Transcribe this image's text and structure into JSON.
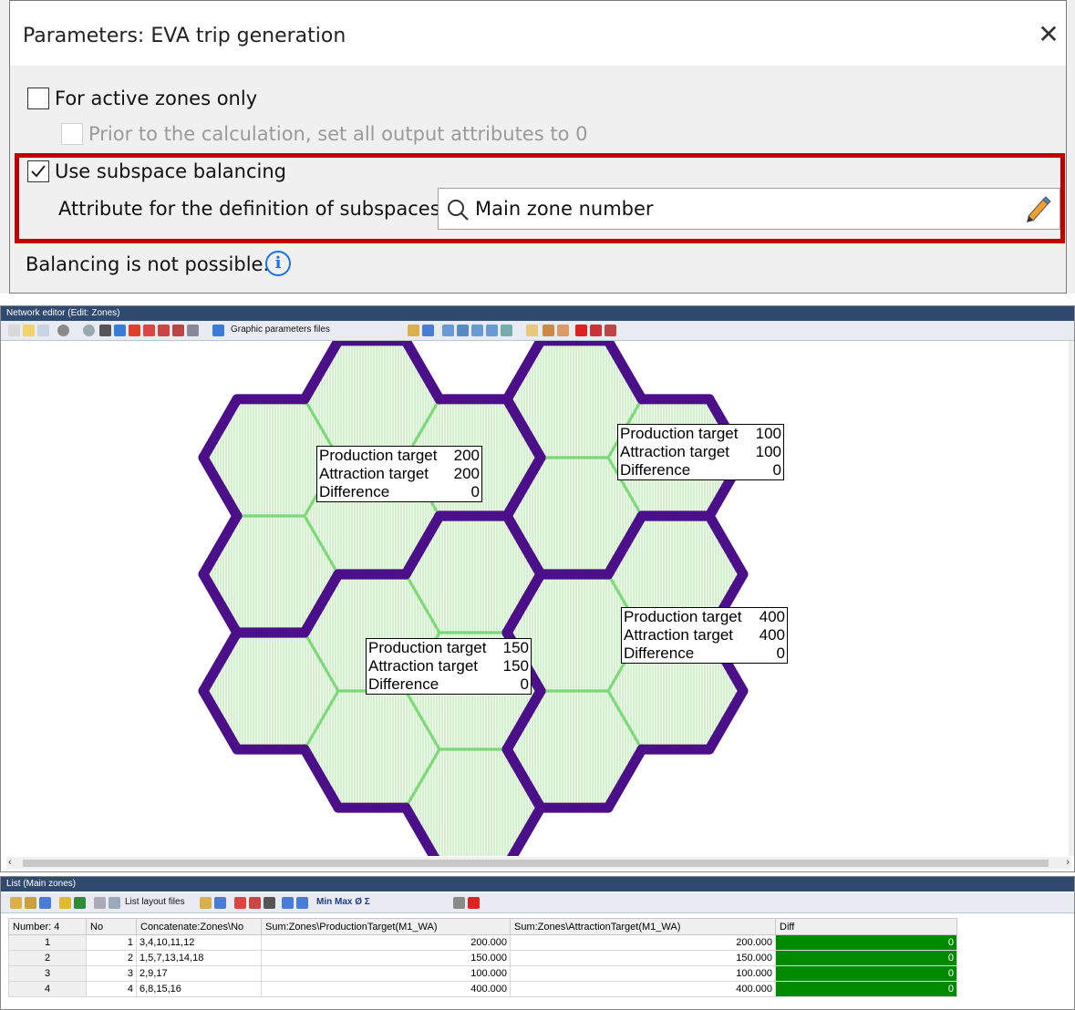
{
  "dialog": {
    "title": "Parameters: EVA trip generation",
    "close_glyph": "✕",
    "active_zones_label": "For active zones only",
    "active_zones_checked": false,
    "prior_calc_label": "Prior to the calculation, set all output attributes to 0",
    "prior_calc_checked": false,
    "subspace_label": "Use subspace balancing",
    "subspace_checked": true,
    "attribute_label": "Attribute for the definition of subspaces:",
    "attribute_value": "Main zone number",
    "status_text": "Balancing is not possible.",
    "info_glyph": "i",
    "highlight_color": "#c00000"
  },
  "network_editor": {
    "title": "Network editor (Edit: Zones)",
    "toolbar_text": "Graphic parameters files",
    "zone_fill": "#d9f2d2",
    "zone_inner_border": "#7dd87a",
    "main_zone_border": "#4b0f8a",
    "labels": [
      {
        "prod_label": "Production target",
        "prod": "200",
        "attr_label": "Attraction target",
        "attr": "200",
        "diff_label": "Difference",
        "diff": "0"
      },
      {
        "prod_label": "Production target",
        "prod": "100",
        "attr_label": "Attraction target",
        "attr": "100",
        "diff_label": "Difference",
        "diff": "0"
      },
      {
        "prod_label": "Production target",
        "prod": "400",
        "attr_label": "Attraction target",
        "attr": "400",
        "diff_label": "Difference",
        "diff": "0"
      },
      {
        "prod_label": "Production target",
        "prod": "150",
        "attr_label": "Attraction target",
        "attr": "150",
        "diff_label": "Difference",
        "diff": "0"
      }
    ]
  },
  "list": {
    "title": "List (Main zones)",
    "toolbar_text": "List layout files",
    "toolbar_minmax": "Min  Max  Ø  Σ",
    "columns": [
      "Number: 4",
      "No",
      "Concatenate:Zones\\No",
      "Sum:Zones\\ProductionTarget(M1_WA)",
      "Sum:Zones\\AttractionTarget(M1_WA)",
      "Diff"
    ],
    "rows": [
      {
        "idx": "1",
        "no": "1",
        "zones": "3,4,10,11,12",
        "prod": "200.000",
        "attr": "200.000",
        "diff": "0"
      },
      {
        "idx": "2",
        "no": "2",
        "zones": "1,5,7,13,14,18",
        "prod": "150.000",
        "attr": "150.000",
        "diff": "0"
      },
      {
        "idx": "3",
        "no": "3",
        "zones": "2,9,17",
        "prod": "100.000",
        "attr": "100.000",
        "diff": "0"
      },
      {
        "idx": "4",
        "no": "4",
        "zones": "6,8,15,16",
        "prod": "400.000",
        "attr": "400.000",
        "diff": "0"
      }
    ],
    "diff_color": "#008a00"
  }
}
